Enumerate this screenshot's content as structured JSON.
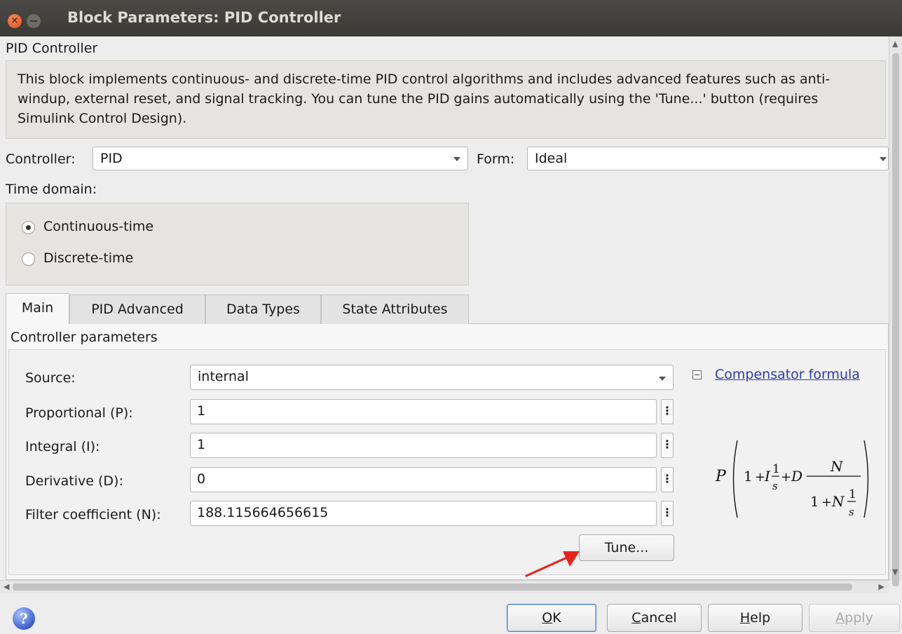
{
  "window": {
    "title": "Block Parameters: PID Controller",
    "close_glyph": "×"
  },
  "block": {
    "name": "PID Controller",
    "description": "This block implements continuous- and discrete-time PID control algorithms and includes advanced features such as anti-windup, external reset, and signal tracking. You can tune the PID gains automatically using the 'Tune...' button (requires Simulink Control Design)."
  },
  "controller": {
    "label": "Controller:",
    "value": "PID"
  },
  "form": {
    "label": "Form:",
    "value": "Ideal"
  },
  "time_domain": {
    "label": "Time domain:",
    "options": [
      {
        "label": "Continuous-time",
        "selected": true
      },
      {
        "label": "Discrete-time",
        "selected": false
      }
    ]
  },
  "tabs": [
    {
      "label": "Main",
      "active": true
    },
    {
      "label": "PID Advanced",
      "active": false
    },
    {
      "label": "Data Types",
      "active": false
    },
    {
      "label": "State Attributes",
      "active": false
    }
  ],
  "params": {
    "section_title": "Controller parameters",
    "source": {
      "label": "Source:",
      "value": "internal"
    },
    "proportional": {
      "label": "Proportional (P):",
      "value": "1"
    },
    "integral": {
      "label": "Integral (I):",
      "value": "1"
    },
    "derivative": {
      "label": "Derivative (D):",
      "value": "0"
    },
    "filter": {
      "label": "Filter coefficient (N):",
      "value": "188.115664656615"
    },
    "tune_label": "Tune...",
    "more_glyph": "⋮"
  },
  "formula": {
    "link_label": "Compensator formula",
    "p": "P",
    "one": "1",
    "plus": "+",
    "i": "I",
    "d": "D",
    "n": "N",
    "s": "s"
  },
  "footer": {
    "help_icon_glyph": "?",
    "ok_mnemonic": "O",
    "ok_rest": "K",
    "cancel_mnemonic": "C",
    "cancel_rest": "ancel",
    "help_mnemonic": "H",
    "help_rest": "elp",
    "apply_mnemonic": "A",
    "apply_rest": "pply"
  },
  "colors": {
    "titlebar": "#3c3b37",
    "link": "#2f3aa6",
    "annotation_arrow": "#e8231b"
  }
}
